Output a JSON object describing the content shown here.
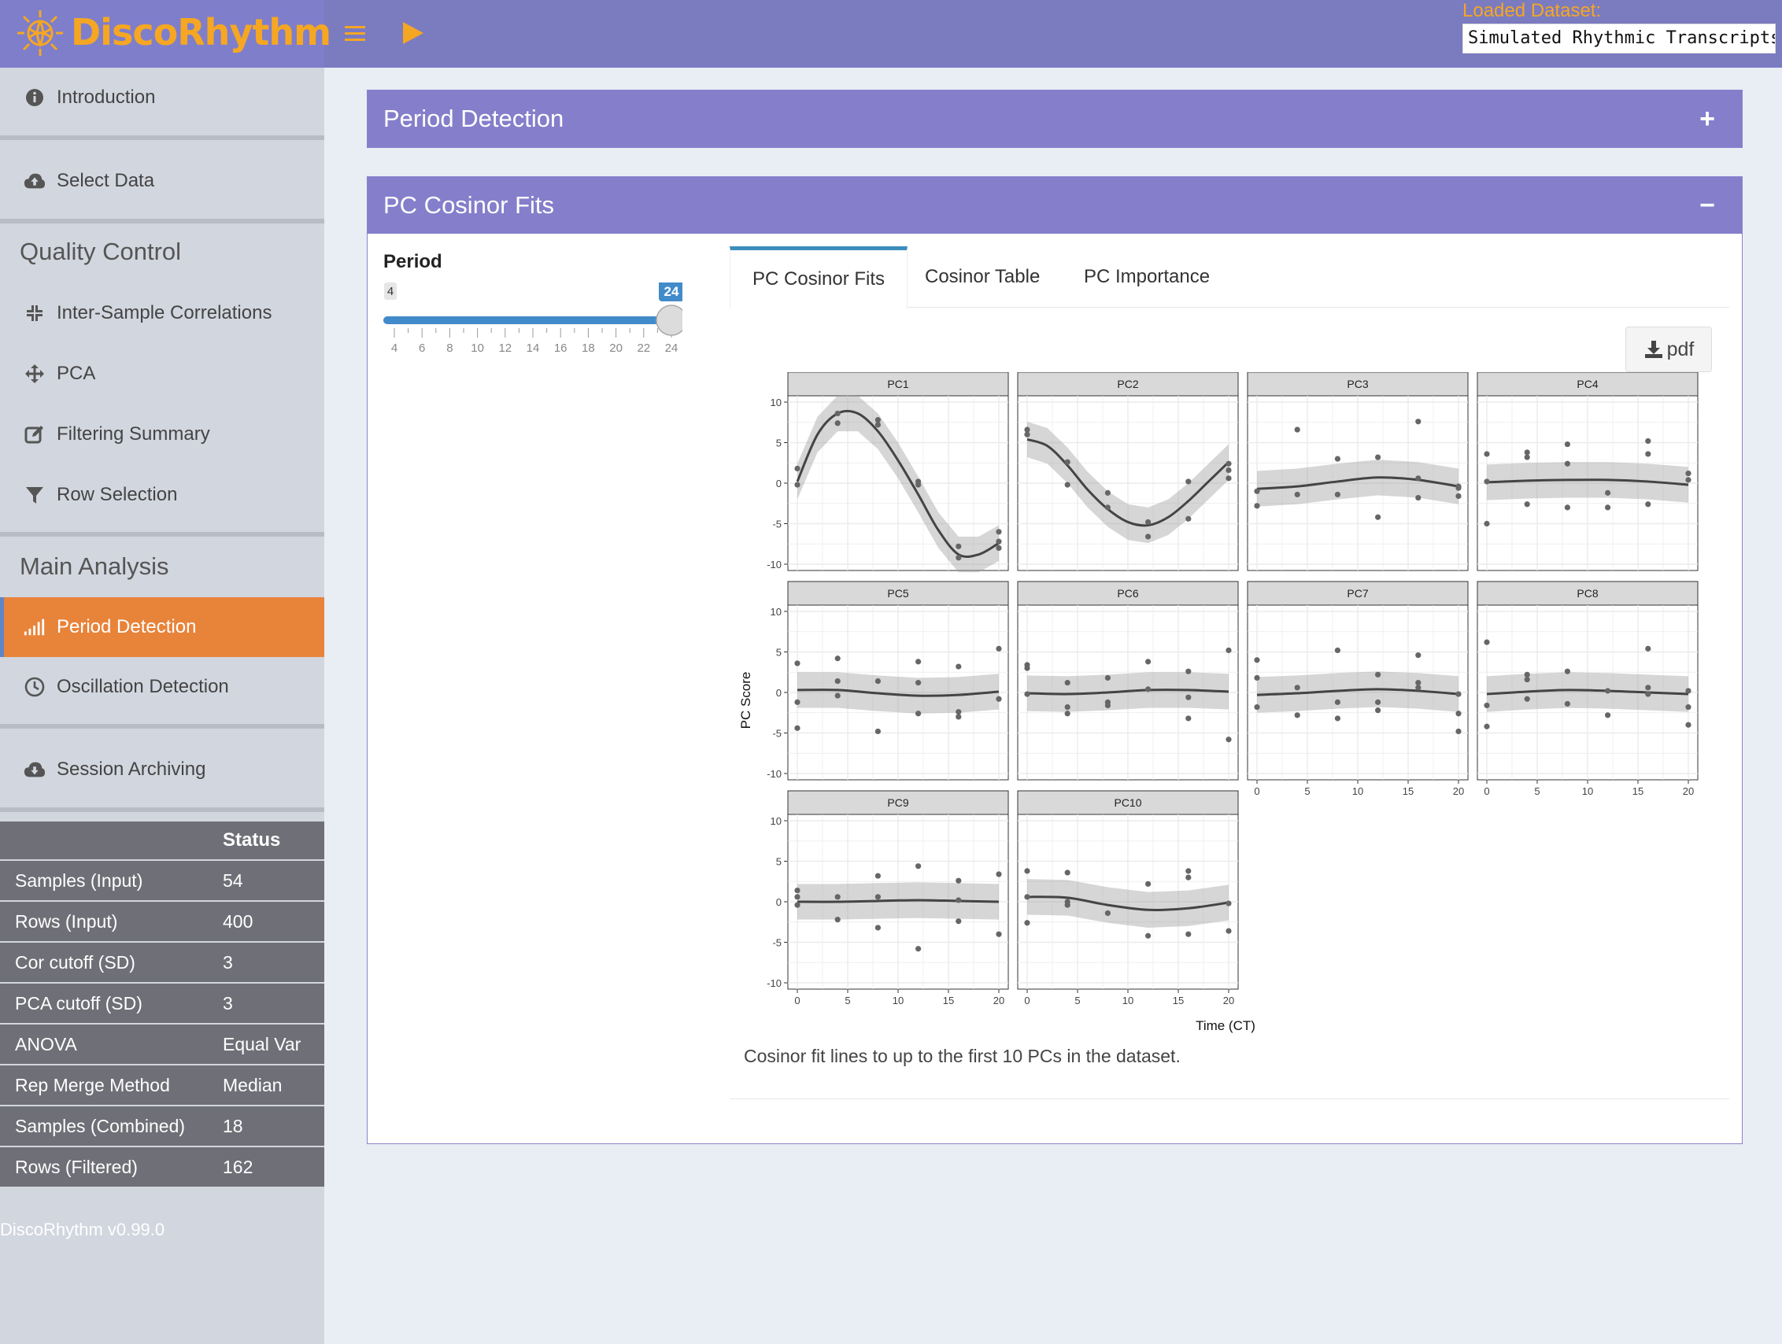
{
  "header": {
    "app_title": "DiscoRhythm",
    "loaded_label": "Loaded Dataset:",
    "loaded_value": "Simulated Rhythmic Transcripts",
    "brand_color": "#f5a623",
    "bar_color": "#7b7bc0",
    "menu_icon": "hamburger-icon",
    "run_icon": "play-icon"
  },
  "sidebar": {
    "items": [
      {
        "label": "Introduction",
        "icon": "info-circle-icon"
      },
      {
        "label": "Select Data",
        "icon": "cloud-upload-icon"
      },
      {
        "label": "Inter-Sample Correlations",
        "icon": "compress-icon"
      },
      {
        "label": "PCA",
        "icon": "arrows-icon"
      },
      {
        "label": "Filtering Summary",
        "icon": "edit-icon"
      },
      {
        "label": "Row Selection",
        "icon": "filter-icon"
      },
      {
        "label": "Period Detection",
        "icon": "signal-bars-icon",
        "active": true
      },
      {
        "label": "Oscillation Detection",
        "icon": "clock-icon"
      },
      {
        "label": "Session Archiving",
        "icon": "cloud-download-icon"
      }
    ],
    "sections": {
      "qc": "Quality Control",
      "main": "Main Analysis"
    },
    "active_color": "#e8833a",
    "status": {
      "header": "Status",
      "rows": [
        {
          "label": "Samples (Input)",
          "value": "54"
        },
        {
          "label": "Rows (Input)",
          "value": "400"
        },
        {
          "label": "Cor cutoff (SD)",
          "value": "3"
        },
        {
          "label": "PCA cutoff (SD)",
          "value": "3"
        },
        {
          "label": "ANOVA",
          "value": "Equal Var"
        },
        {
          "label": "Rep Merge Method",
          "value": "Median"
        },
        {
          "label": "Samples (Combined)",
          "value": "18"
        },
        {
          "label": "Rows (Filtered)",
          "value": "162"
        }
      ]
    },
    "version": "DiscoRhythm v0.99.0"
  },
  "main": {
    "box1": {
      "title": "Period Detection",
      "tool": "+"
    },
    "box2": {
      "title": "PC Cosinor Fits",
      "tool": "−",
      "period": {
        "label": "Period",
        "min": 4,
        "max": 24,
        "value": 24,
        "min_label": "4",
        "value_label": "24",
        "ticks": [
          "4",
          "6",
          "8",
          "10",
          "12",
          "14",
          "16",
          "18",
          "20",
          "22",
          "24"
        ]
      },
      "tabs": [
        "PC Cosinor Fits",
        "Cosinor Table",
        "PC Importance"
      ],
      "pdf_label": "pdf",
      "caption": "Cosinor fit lines to up to the first 10 PCs in the dataset."
    }
  },
  "chart_data": {
    "type": "scatter",
    "xlabel": "Time (CT)",
    "ylabel": "PC Score",
    "xlim": [
      0,
      20
    ],
    "ylim": [
      -10,
      10
    ],
    "xticks": [
      0,
      5,
      10,
      15,
      20
    ],
    "yticks": [
      -10,
      -5,
      0,
      5,
      10
    ],
    "facets": [
      {
        "name": "PC1",
        "points": [
          [
            0,
            -0.2
          ],
          [
            0,
            1.8
          ],
          [
            4,
            7.4
          ],
          [
            4,
            8.6
          ],
          [
            8,
            7.8
          ],
          [
            8,
            7.2
          ],
          [
            12,
            -0.2
          ],
          [
            12,
            0.2
          ],
          [
            16,
            -7.8
          ],
          [
            16,
            -9.2
          ],
          [
            20,
            -6.0
          ],
          [
            20,
            -7.2
          ],
          [
            20,
            -8.0
          ]
        ],
        "fit": [
          [
            0,
            0.2
          ],
          [
            2,
            6.0
          ],
          [
            4,
            8.6
          ],
          [
            6,
            8.6
          ],
          [
            8,
            6.4
          ],
          [
            10,
            2.8
          ],
          [
            12,
            -1.4
          ],
          [
            14,
            -5.8
          ],
          [
            16,
            -8.8
          ],
          [
            18,
            -8.8
          ],
          [
            20,
            -7.4
          ]
        ]
      },
      {
        "name": "PC2",
        "points": [
          [
            0,
            6.6
          ],
          [
            0,
            6.0
          ],
          [
            4,
            2.6
          ],
          [
            4,
            -0.2
          ],
          [
            8,
            -1.2
          ],
          [
            8,
            -3.0
          ],
          [
            12,
            -6.6
          ],
          [
            12,
            -4.8
          ],
          [
            16,
            0.2
          ],
          [
            16,
            -4.4
          ],
          [
            20,
            2.4
          ],
          [
            20,
            1.6
          ],
          [
            20,
            0.6
          ]
        ],
        "fit": [
          [
            0,
            5.4
          ],
          [
            2,
            4.6
          ],
          [
            4,
            2.2
          ],
          [
            6,
            -0.8
          ],
          [
            8,
            -3.2
          ],
          [
            10,
            -4.8
          ],
          [
            12,
            -5.2
          ],
          [
            14,
            -4.2
          ],
          [
            16,
            -2.2
          ],
          [
            18,
            0.2
          ],
          [
            20,
            2.6
          ]
        ]
      },
      {
        "name": "PC3",
        "points": [
          [
            0,
            -1.0
          ],
          [
            0,
            -2.8
          ],
          [
            4,
            6.6
          ],
          [
            4,
            -1.4
          ],
          [
            8,
            3.0
          ],
          [
            8,
            -1.4
          ],
          [
            12,
            3.2
          ],
          [
            12,
            -4.2
          ],
          [
            16,
            7.6
          ],
          [
            16,
            0.6
          ],
          [
            16,
            -1.8
          ],
          [
            20,
            -0.6
          ],
          [
            20,
            -1.6
          ],
          [
            20,
            -0.4
          ]
        ],
        "fit": [
          [
            0,
            -0.7
          ],
          [
            4,
            -0.4
          ],
          [
            8,
            0.2
          ],
          [
            12,
            0.7
          ],
          [
            16,
            0.4
          ],
          [
            20,
            -0.4
          ]
        ]
      },
      {
        "name": "PC4",
        "points": [
          [
            0,
            3.6
          ],
          [
            0,
            0.2
          ],
          [
            0,
            -5.0
          ],
          [
            4,
            3.8
          ],
          [
            4,
            3.2
          ],
          [
            4,
            -2.6
          ],
          [
            8,
            4.8
          ],
          [
            8,
            2.4
          ],
          [
            8,
            -3.0
          ],
          [
            12,
            -1.2
          ],
          [
            12,
            -3.0
          ],
          [
            16,
            5.2
          ],
          [
            16,
            3.6
          ],
          [
            16,
            -2.6
          ],
          [
            20,
            1.2
          ],
          [
            20,
            0.4
          ]
        ],
        "fit": [
          [
            0,
            0.1
          ],
          [
            4,
            0.3
          ],
          [
            8,
            0.4
          ],
          [
            12,
            0.4
          ],
          [
            16,
            0.2
          ],
          [
            20,
            -0.2
          ]
        ]
      },
      {
        "name": "PC5",
        "points": [
          [
            0,
            3.6
          ],
          [
            0,
            -1.2
          ],
          [
            0,
            -4.4
          ],
          [
            4,
            4.2
          ],
          [
            4,
            1.4
          ],
          [
            4,
            -0.4
          ],
          [
            8,
            1.4
          ],
          [
            8,
            -4.8
          ],
          [
            12,
            3.8
          ],
          [
            12,
            1.2
          ],
          [
            12,
            -2.6
          ],
          [
            16,
            3.2
          ],
          [
            16,
            -2.4
          ],
          [
            16,
            -3.0
          ],
          [
            20,
            5.4
          ],
          [
            20,
            -0.8
          ]
        ],
        "fit": [
          [
            0,
            0.3
          ],
          [
            4,
            0.3
          ],
          [
            8,
            -0.1
          ],
          [
            12,
            -0.4
          ],
          [
            16,
            -0.3
          ],
          [
            20,
            0.1
          ]
        ]
      },
      {
        "name": "PC6",
        "points": [
          [
            0,
            3.4
          ],
          [
            0,
            3.0
          ],
          [
            0,
            -0.2
          ],
          [
            4,
            1.2
          ],
          [
            4,
            -1.8
          ],
          [
            4,
            -2.6
          ],
          [
            8,
            1.8
          ],
          [
            8,
            -1.2
          ],
          [
            8,
            -1.6
          ],
          [
            12,
            3.8
          ],
          [
            12,
            0.4
          ],
          [
            16,
            2.6
          ],
          [
            16,
            -0.6
          ],
          [
            16,
            -3.2
          ],
          [
            20,
            5.2
          ],
          [
            20,
            -5.8
          ]
        ],
        "fit": [
          [
            0,
            -0.1
          ],
          [
            4,
            -0.2
          ],
          [
            8,
            0.0
          ],
          [
            12,
            0.3
          ],
          [
            16,
            0.3
          ],
          [
            20,
            0.1
          ]
        ]
      },
      {
        "name": "PC7",
        "points": [
          [
            0,
            4.0
          ],
          [
            0,
            1.8
          ],
          [
            0,
            -1.8
          ],
          [
            4,
            0.6
          ],
          [
            4,
            -2.8
          ],
          [
            8,
            5.2
          ],
          [
            8,
            -1.2
          ],
          [
            8,
            -3.2
          ],
          [
            12,
            2.2
          ],
          [
            12,
            -1.2
          ],
          [
            12,
            -2.2
          ],
          [
            16,
            4.6
          ],
          [
            16,
            1.2
          ],
          [
            16,
            0.6
          ],
          [
            20,
            -0.2
          ],
          [
            20,
            -2.6
          ],
          [
            20,
            -4.8
          ]
        ],
        "fit": [
          [
            0,
            -0.3
          ],
          [
            4,
            -0.1
          ],
          [
            8,
            0.2
          ],
          [
            12,
            0.4
          ],
          [
            16,
            0.2
          ],
          [
            20,
            -0.2
          ]
        ]
      },
      {
        "name": "PC8",
        "points": [
          [
            0,
            6.2
          ],
          [
            0,
            -1.6
          ],
          [
            0,
            -4.2
          ],
          [
            4,
            2.2
          ],
          [
            4,
            1.6
          ],
          [
            4,
            -0.8
          ],
          [
            8,
            2.6
          ],
          [
            8,
            -1.4
          ],
          [
            12,
            0.2
          ],
          [
            12,
            -2.8
          ],
          [
            16,
            5.4
          ],
          [
            16,
            0.6
          ],
          [
            16,
            -0.2
          ],
          [
            20,
            -1.8
          ],
          [
            20,
            -4.0
          ],
          [
            20,
            0.2
          ]
        ],
        "fit": [
          [
            0,
            -0.2
          ],
          [
            4,
            0.1
          ],
          [
            8,
            0.3
          ],
          [
            12,
            0.2
          ],
          [
            16,
            0.0
          ],
          [
            20,
            -0.2
          ]
        ]
      },
      {
        "name": "PC9",
        "points": [
          [
            0,
            1.4
          ],
          [
            0,
            0.6
          ],
          [
            0,
            -0.4
          ],
          [
            4,
            0.6
          ],
          [
            4,
            -2.2
          ],
          [
            8,
            3.2
          ],
          [
            8,
            0.6
          ],
          [
            8,
            -3.2
          ],
          [
            12,
            4.4
          ],
          [
            12,
            -5.8
          ],
          [
            16,
            2.6
          ],
          [
            16,
            0.2
          ],
          [
            16,
            -2.4
          ],
          [
            20,
            3.4
          ],
          [
            20,
            -4.0
          ]
        ],
        "fit": [
          [
            0,
            0.0
          ],
          [
            4,
            0.0
          ],
          [
            8,
            0.1
          ],
          [
            12,
            0.2
          ],
          [
            16,
            0.1
          ],
          [
            20,
            0.0
          ]
        ]
      },
      {
        "name": "PC10",
        "points": [
          [
            0,
            3.8
          ],
          [
            0,
            0.6
          ],
          [
            0,
            -2.6
          ],
          [
            4,
            3.6
          ],
          [
            4,
            0.0
          ],
          [
            4,
            -0.4
          ],
          [
            8,
            -1.4
          ],
          [
            12,
            2.2
          ],
          [
            12,
            -4.2
          ],
          [
            16,
            3.8
          ],
          [
            16,
            3.0
          ],
          [
            16,
            -4.0
          ],
          [
            20,
            -0.2
          ],
          [
            20,
            -3.6
          ]
        ],
        "fit": [
          [
            0,
            0.6
          ],
          [
            4,
            0.5
          ],
          [
            8,
            -0.4
          ],
          [
            12,
            -1.0
          ],
          [
            16,
            -0.8
          ],
          [
            20,
            -0.1
          ]
        ]
      }
    ]
  }
}
